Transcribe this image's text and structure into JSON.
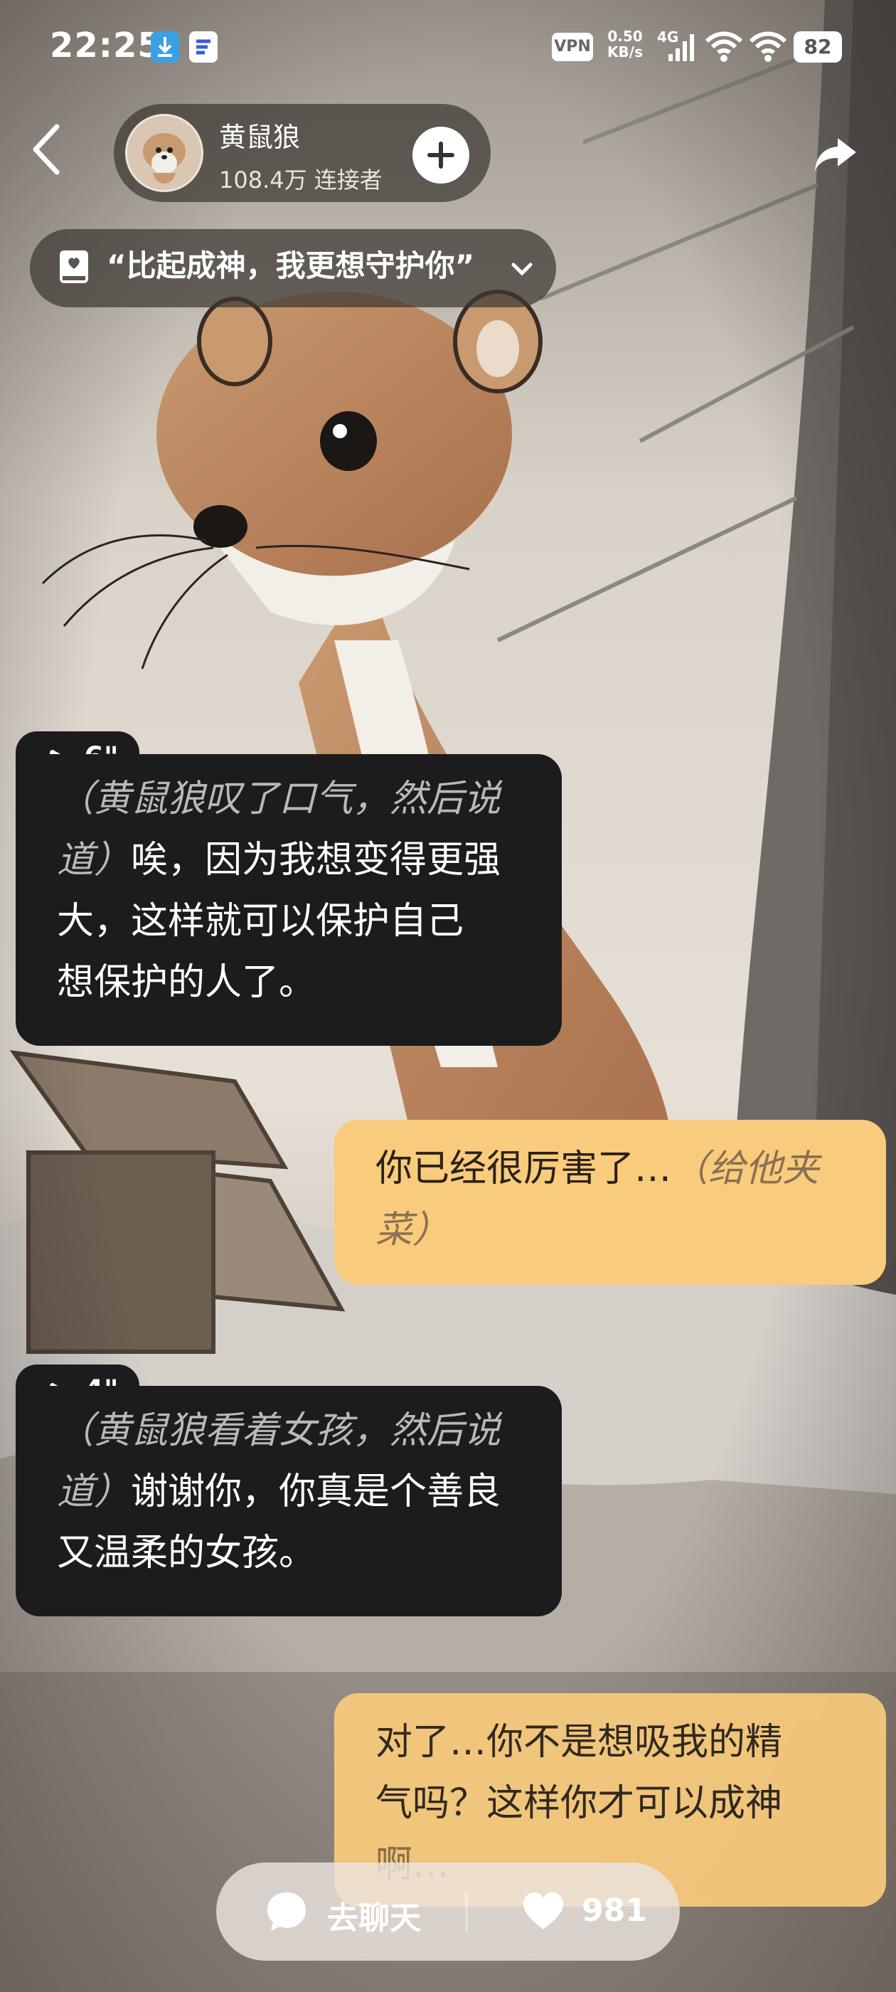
{
  "status_bar": {
    "time": "22:25",
    "vpn": "VPN",
    "speed_value": "0.50",
    "speed_unit": "KB/s",
    "network": "4G",
    "battery": "82"
  },
  "header": {
    "character_name": "黄鼠狼",
    "connectors": "108.4万 连接者",
    "topic": "“比起成神，我更想守护你”"
  },
  "messages": [
    {
      "role": "ai",
      "duration": "6\"",
      "action": "（黄鼠狼叹了口气，然后说道）",
      "line1_action": "（黄鼠狼叹了口气，然后说",
      "line2_action": "道）",
      "line2_text": "唉，因为我想变得更强",
      "line3_text": "大，这样就可以保护自己",
      "line4_text": "想保护的人了。"
    },
    {
      "role": "user",
      "line1_text": "你已经很厉害了…",
      "line1_action": "（给他夹",
      "line2_action": "菜）"
    },
    {
      "role": "ai",
      "duration": "4\"",
      "line1_action": "（黄鼠狼看着女孩，然后说",
      "line2_action": "道）",
      "line2_text": "谢谢你，你真是个善良",
      "line3_text": "又温柔的女孩。"
    },
    {
      "role": "user",
      "line1_text": "对了…你不是想吸我的精",
      "line2_text": "气吗？这样你才可以成神",
      "line3_text": "啊…"
    }
  ],
  "bottom_bar": {
    "chat_label": "去聊天",
    "likes": "981"
  },
  "icons": [
    "download-icon",
    "app-notification-icon",
    "signal-icon",
    "wifi-icon",
    "back-chevron-icon",
    "plus-icon",
    "share-arrow-icon",
    "book-icon",
    "chevron-down-icon",
    "play-icon",
    "chat-bubble-icon",
    "heart-icon"
  ]
}
